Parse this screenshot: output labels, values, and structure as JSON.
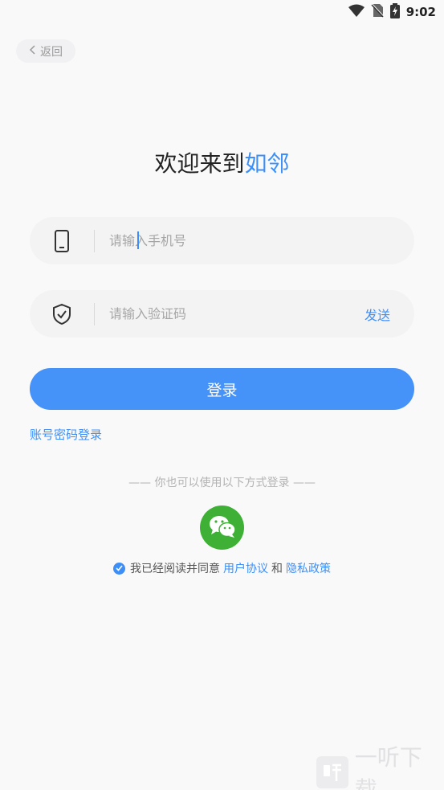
{
  "status": {
    "time": "9:02"
  },
  "nav": {
    "back_label": "返回"
  },
  "title": {
    "prefix": "欢迎来到",
    "brand": "如邻"
  },
  "phone": {
    "placeholder": "请输入手机号"
  },
  "code": {
    "placeholder": "请输入验证码",
    "send_label": "发送"
  },
  "login": {
    "label": "登录"
  },
  "password_login": {
    "label": "账号密码登录"
  },
  "alt_login": {
    "label": "—— 你也可以使用以下方式登录 ——"
  },
  "agreement": {
    "prefix": "我已经阅读并同意",
    "terms": "用户协议",
    "and": "和",
    "privacy": "隐私政策"
  },
  "watermark": {
    "text": "一听下载"
  },
  "colors": {
    "accent": "#4592f8",
    "wechat": "#3eb035",
    "background": "#f9f9fa"
  },
  "icons": {
    "phone": "phone-icon",
    "shield": "shield-check-icon",
    "wechat": "wechat-icon"
  }
}
